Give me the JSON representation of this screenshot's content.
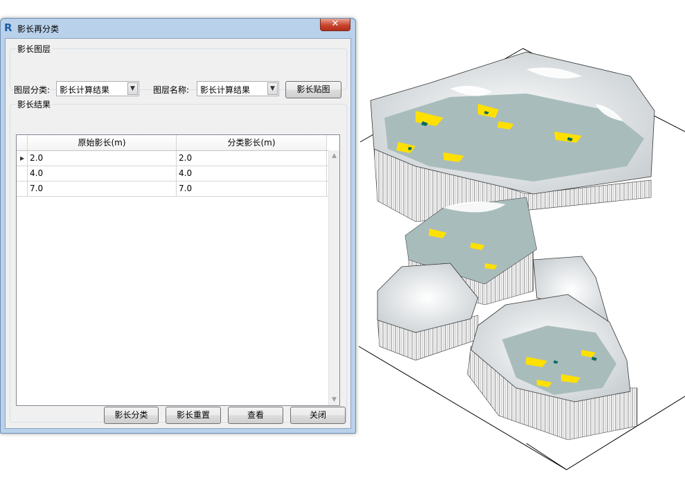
{
  "window": {
    "title": "影长再分类",
    "app_icon_glyph": "R",
    "close_glyph": "✕"
  },
  "group_layer": {
    "legend": "影长图层",
    "category_label": "图层分类:",
    "category_value": "影长计算结果",
    "name_label": "图层名称:",
    "name_value": "影长计算结果",
    "map_button": "影长贴图"
  },
  "group_result": {
    "legend": "影长结果",
    "columns": [
      "原始影长(m)",
      "分类影长(m)"
    ],
    "rows": [
      {
        "original": "2.0",
        "classified": "2.0"
      },
      {
        "original": "4.0",
        "classified": "4.0"
      },
      {
        "original": "7.0",
        "classified": "7.0"
      }
    ]
  },
  "footer": {
    "classify": "影长分类",
    "reset": "影长重置",
    "view": "查看",
    "close": "关闭"
  },
  "colors": {
    "title_bg": "#b9d1ea",
    "close_red": "#c9452e",
    "terrain_yellow": "#ffe000",
    "terrain_teal": "#0a6b5c",
    "terrain_gray": "#a9bcbc"
  }
}
